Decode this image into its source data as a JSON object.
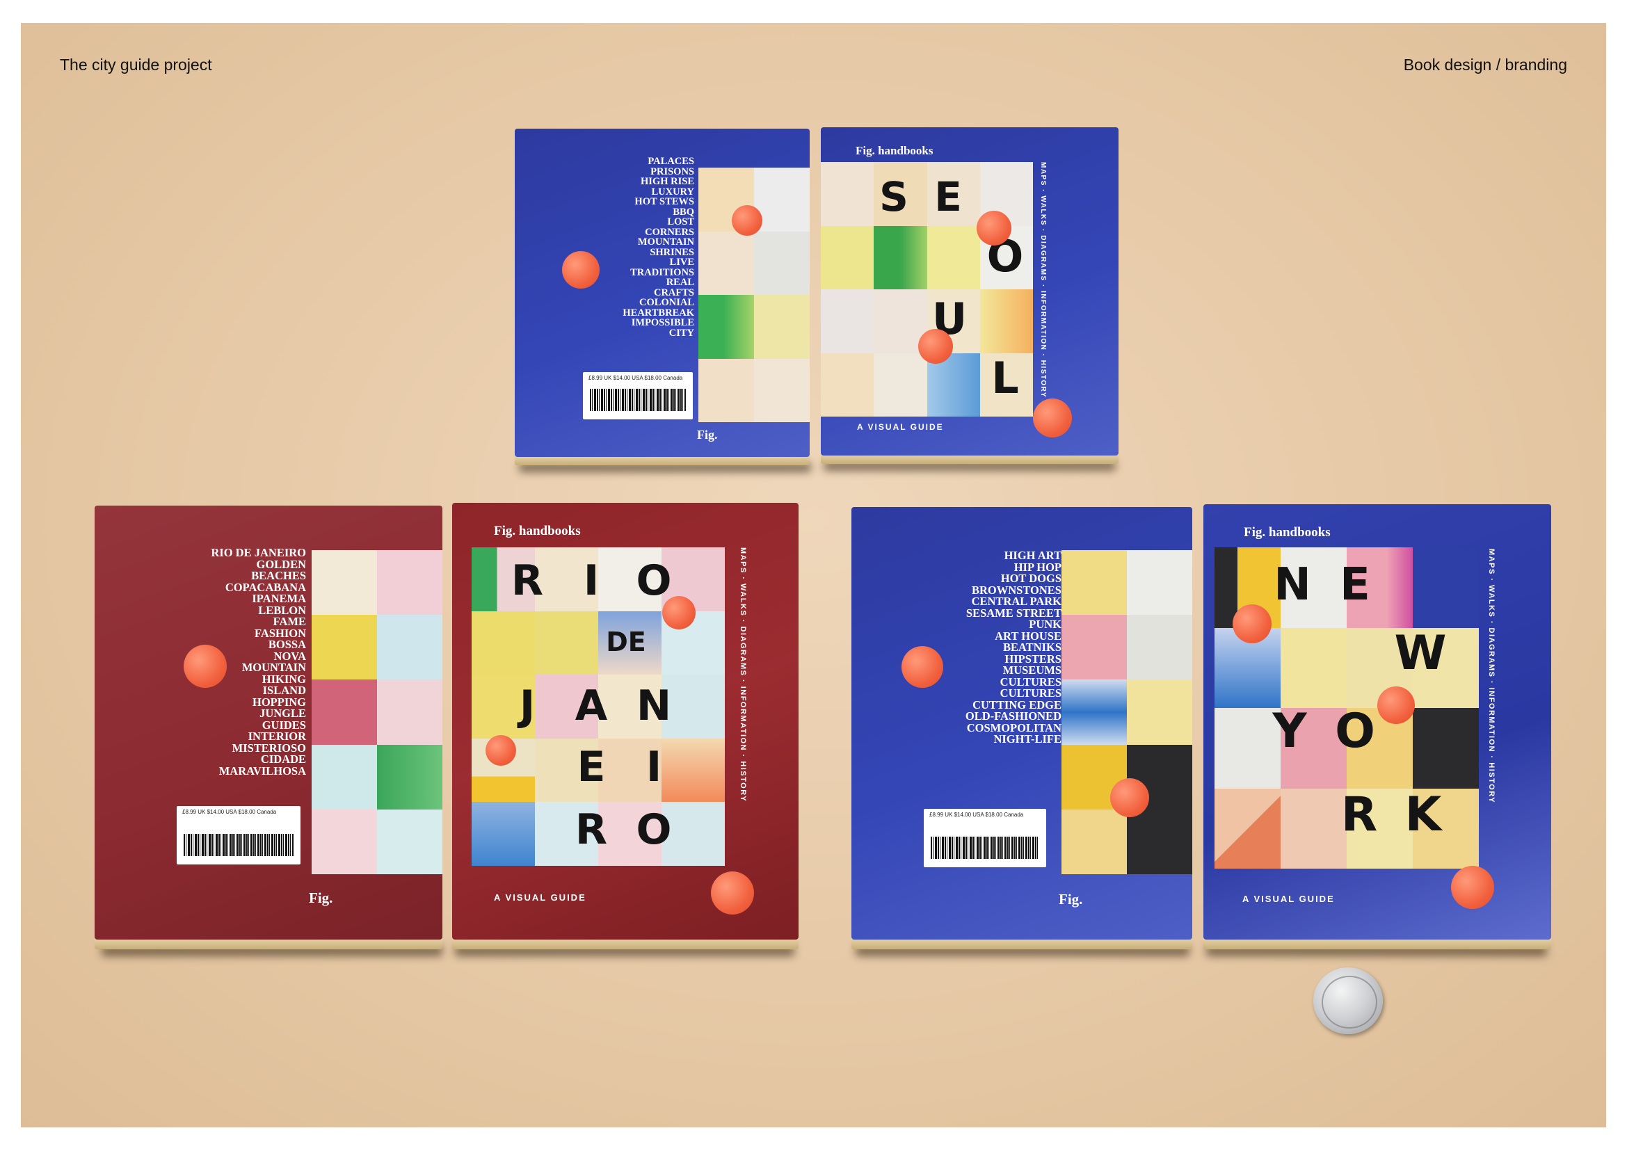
{
  "header": {
    "left_title": "The city guide project",
    "right_title": "Book design / branding"
  },
  "books": {
    "seoul": {
      "back_words": [
        "PALACES",
        "PRISONS",
        "HIGH RISE",
        "LUXURY",
        "HOT STEWS",
        "BBQ",
        "LOST",
        "CORNERS",
        "MOUNTAIN",
        "SHRINES",
        "LIVE",
        "TRADITIONS",
        "REAL",
        "CRAFTS",
        "COLONIAL",
        "HEARTBREAK",
        "IMPOSSIBLE",
        "CITY"
      ],
      "price": "£8.99 UK  $14.00 USA  $18.00 Canada",
      "brand": "Fig. handbooks",
      "back_logo": "Fig.",
      "title_letters": [
        "S",
        "E",
        "O",
        "U",
        "L"
      ],
      "tagline": "A VISUAL GUIDE",
      "spine": "MAPS · WALKS · DIAGRAMS · INFORMATION · HISTORY"
    },
    "rio": {
      "back_words": [
        "RIO DE JANEIRO",
        "GOLDEN",
        "BEACHES",
        "COPACABANA",
        "IPANEMA",
        "LEBLON",
        "FAME",
        "FASHION",
        "BOSSA",
        "NOVA",
        "MOUNTAIN",
        "HIKING",
        "ISLAND",
        "HOPPING",
        "JUNGLE",
        "GUIDES",
        "INTERIOR",
        "MISTERIOSO",
        "CIDADE",
        "MARAVILHOSA"
      ],
      "price": "£8.99 UK  $14.00 USA  $18.00 Canada",
      "brand": "Fig. handbooks",
      "back_logo": "Fig.",
      "title_letters": [
        "R",
        "I",
        "O",
        "DE",
        "J",
        "A",
        "N",
        "E",
        "I",
        "R",
        "O"
      ],
      "tagline": "A VISUAL GUIDE",
      "spine": "MAPS · WALKS · DIAGRAMS · INFORMATION · HISTORY"
    },
    "newyork": {
      "back_words": [
        "HIGH ART",
        "HIP HOP",
        "HOT DOGS",
        "BROWNSTONES",
        "CENTRAL PARK",
        "SESAME STREET",
        "PUNK",
        "ART HOUSE",
        "BEATNIKS",
        "HIPSTERS",
        "MUSEUMS",
        "CULTURES",
        "CULTURES",
        "CUTTING EDGE",
        "OLD-FASHIONED",
        "COSMOPOLITAN",
        "NIGHT-LIFE"
      ],
      "price": "£8.99 UK  $14.00 USA  $18.00 Canada",
      "brand": "Fig. handbooks",
      "back_logo": "Fig.",
      "title_letters": [
        "N",
        "E",
        "W",
        "Y",
        "O",
        "R",
        "K"
      ],
      "tagline": "A VISUAL GUIDE",
      "spine": "MAPS · WALKS · DIAGRAMS · INFORMATION · HISTORY"
    }
  },
  "colors": {
    "blue_cover": "#3343b0",
    "red_cover": "#8f2a30",
    "accent_dot": "#f2623f",
    "background": "#e8caa6"
  },
  "coin": {
    "icon": "coin-icon"
  }
}
